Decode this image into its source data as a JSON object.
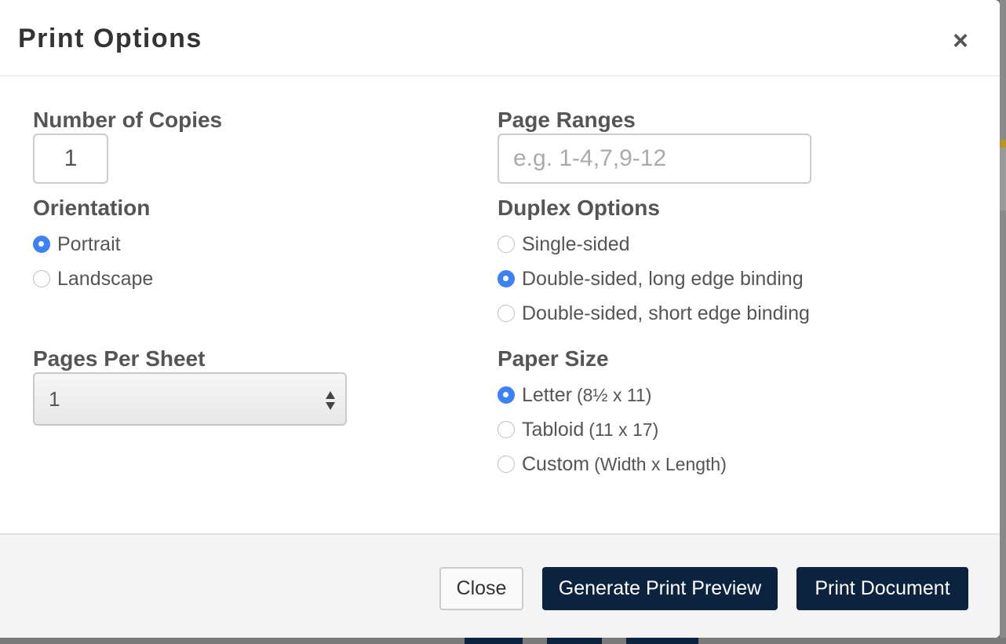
{
  "dialog": {
    "title": "Print Options",
    "close_icon": "close-icon"
  },
  "copies": {
    "label": "Number of Copies",
    "value": "1"
  },
  "page_ranges": {
    "label": "Page Ranges",
    "value": "",
    "placeholder": "e.g. 1-4,7,9-12"
  },
  "orientation": {
    "label": "Orientation",
    "options": [
      {
        "label": "Portrait",
        "selected": true
      },
      {
        "label": "Landscape",
        "selected": false
      }
    ]
  },
  "duplex": {
    "label": "Duplex Options",
    "options": [
      {
        "label": "Single-sided",
        "selected": false
      },
      {
        "label": "Double-sided, long edge binding",
        "selected": true
      },
      {
        "label": "Double-sided, short edge binding",
        "selected": false
      }
    ]
  },
  "pages_per_sheet": {
    "label": "Pages Per Sheet",
    "selected": "1"
  },
  "paper_size": {
    "label": "Paper Size",
    "options": [
      {
        "label": "Letter",
        "detail": "(8½ x 11)",
        "selected": true
      },
      {
        "label": "Tabloid",
        "detail": "(11 x 17)",
        "selected": false
      },
      {
        "label": "Custom",
        "detail": "(Width x Length)",
        "selected": false
      }
    ]
  },
  "footer": {
    "close_label": "Close",
    "preview_label": "Generate Print Preview",
    "print_label": "Print Document"
  },
  "colors": {
    "primary_button": "#0c2340",
    "radio_selected": "#3b82f6"
  }
}
